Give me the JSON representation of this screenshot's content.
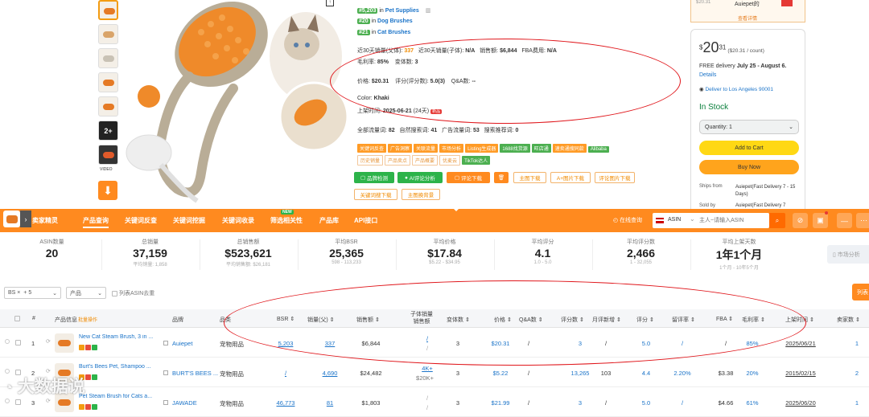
{
  "product": {
    "ranks": [
      {
        "badge": "#5,203",
        "in": "in",
        "category": "Pet Supplies"
      },
      {
        "badge": "#20",
        "in": "in",
        "category": "Dog Brushes"
      },
      {
        "badge": "#21",
        "in": "in",
        "category": "Cat Brushes"
      }
    ],
    "video_label": "VIDEO",
    "thumb_more": "2+",
    "sales30_parent_label": "近30天销量(父体):",
    "sales30_parent_value": "337",
    "sales30_child_label": "近30天销量(子体):",
    "sales30_child_value": "N/A",
    "sales_amount_label": "销售额:",
    "sales_amount_value": "$6,844",
    "fba_fee_label": "FBA费用:",
    "fba_fee_value": "N/A",
    "margin_label": "毛利率:",
    "margin_value": "85%",
    "variants_label": "变体数:",
    "variants_value": "3",
    "price_label": "价格:",
    "price_value": "$20.31",
    "rating_label": "评分(评分数):",
    "rating_value": "5.0(3)",
    "qa_label": "Q&A数:",
    "qa_value": "--",
    "color_label": "Color:",
    "color_value": "Khaki",
    "listed_label": "上架时间:",
    "listed_value": "2025-06-21",
    "listed_days": "(24天)",
    "new_badge": "新品",
    "kw_total_label": "全部流量词:",
    "kw_total_value": "82",
    "kw_natural_label": "自然搜索词:",
    "kw_natural_value": "41",
    "kw_ad_label": "广告流量词:",
    "kw_ad_value": "53",
    "kw_recommend_label": "搜索推荐词:",
    "kw_recommend_value": "0",
    "tags_row1": [
      "关键词反查",
      "广告洞察",
      "关联流量",
      "市场分析",
      "Listing生成器",
      "1688找货源",
      "旺店通",
      "速卖通搜同款",
      "Alibaba"
    ],
    "tags_row2": [
      "历史销量",
      "产品卖点",
      "产品概要",
      "优麦云",
      "TikTok达人"
    ],
    "buttons": [
      "品牌检测",
      "AI评论分析",
      "评论下载",
      "",
      "主图下载",
      "A+图片下载",
      "评论图片下载"
    ],
    "buttons_row2": [
      "关键词搜下载",
      "主图换背景"
    ]
  },
  "buybox": {
    "seller_top": "Auiepet的",
    "price_top": "$20.31",
    "view_details": "查看详情",
    "price_dollar": "$",
    "price_main": "20",
    "price_cents": "31",
    "price_per": "($20.31 / count)",
    "delivery_prefix": "FREE delivery",
    "delivery_dates": "July 25 - August 6.",
    "details_link": "Details",
    "deliver_to": "Deliver to Los Angeles 90001",
    "in_stock": "In Stock",
    "quantity": "Quantity: 1",
    "add_to_cart": "Add to Cart",
    "buy_now": "Buy Now",
    "ships_from_label": "Ships from",
    "ships_from_value": "Auiepet(Fast Delivery 7 - 15 Days)",
    "sold_by_label": "Sold by",
    "sold_by_value": "Auiepet(Fast Delivery 7"
  },
  "nav": {
    "brand": "卖家精灵",
    "items": [
      "产品查询",
      "关键词反查",
      "关键词挖掘",
      "关键词收录",
      "筛选相关性",
      "产品库",
      "API接口"
    ],
    "new_label": "NEW",
    "online_query": "在线查询",
    "search_type": "ASIN",
    "search_placeholder": "主人~请输入ASIN"
  },
  "stats": [
    {
      "label": "ASIN数量",
      "value": "20",
      "sub": ""
    },
    {
      "label": "总销量",
      "value": "37,159",
      "sub": "平均销量: 1,858"
    },
    {
      "label": "总销售额",
      "value": "$523,621",
      "sub": "平均销售额: $26,181"
    },
    {
      "label": "平均BSR",
      "value": "25,365",
      "sub": "598 - 113,233"
    },
    {
      "label": "平均价格",
      "value": "$17.84",
      "sub": "$5.22 - $34.95"
    },
    {
      "label": "平均评分",
      "value": "4.1",
      "sub": "1.0 - 5.0"
    },
    {
      "label": "平均评分数",
      "value": "2,466",
      "sub": "1 - 32,055"
    },
    {
      "label": "平均上架天数",
      "value": "1年1个月",
      "sub": "1个月 - 10年5个月"
    }
  ],
  "market_btn": "市场分析",
  "filters": {
    "chip1": "BS",
    "chip1_x": "×",
    "chip1_more": "+ 5",
    "category": "产品",
    "dedupe_label": "列表ASIN去重",
    "list_btn": "列表"
  },
  "table": {
    "headers": [
      "#",
      "产品信息",
      "批量操作",
      "品牌",
      "品类",
      "BSR",
      "销量(父)",
      "销售额",
      "子体销量",
      "销售额",
      "变体数",
      "价格",
      "Q&A数",
      "评分数",
      "月评新增",
      "评分",
      "留评率",
      "FBA",
      "毛利率",
      "上架时间",
      "卖家数"
    ],
    "rows": [
      {
        "num": "1",
        "name": "New Cat Steam Brush, 3 in ...",
        "brand": "Auiepet",
        "category": "宠物用品",
        "bsr": "5,203",
        "sales": "337",
        "revenue": "$6,844",
        "child": "/",
        "variants": "3",
        "price": "$20.31",
        "qa": "/",
        "reviews": "3",
        "new_reviews": "/",
        "rating": "5.0",
        "review_rate": "/",
        "fba": "/",
        "margin": "85%",
        "date": "2025/06/21",
        "sellers": "1"
      },
      {
        "num": "2",
        "name": "Burt's Bees Pet, Shampoo ...",
        "brand": "BURT'S BEES ...",
        "category": "宠物用品",
        "bsr": "/",
        "sales": "4,690",
        "revenue": "$24,482",
        "child": "4K+",
        "child2": "$20K+",
        "variants": "3",
        "price": "$5.22",
        "qa": "/",
        "reviews": "13,265",
        "new_reviews": "103",
        "rating": "4.4",
        "review_rate": "2.20%",
        "fba": "$3.38",
        "margin": "20%",
        "date": "2015/02/15",
        "sellers": "2"
      },
      {
        "num": "3",
        "name": "Pet Steam Brush for Cats a...",
        "brand": "JAWADE",
        "category": "宠物用品",
        "bsr": "46,773",
        "sales": "81",
        "revenue": "$1,803",
        "child": "",
        "variants": "3",
        "price": "$21.99",
        "qa": "/",
        "reviews": "3",
        "new_reviews": "/",
        "rating": "5.0",
        "review_rate": "/",
        "fba": "$4.66",
        "margin": "61%",
        "date": "2025/06/20",
        "sellers": "1"
      }
    ]
  },
  "watermark": "大数据说"
}
